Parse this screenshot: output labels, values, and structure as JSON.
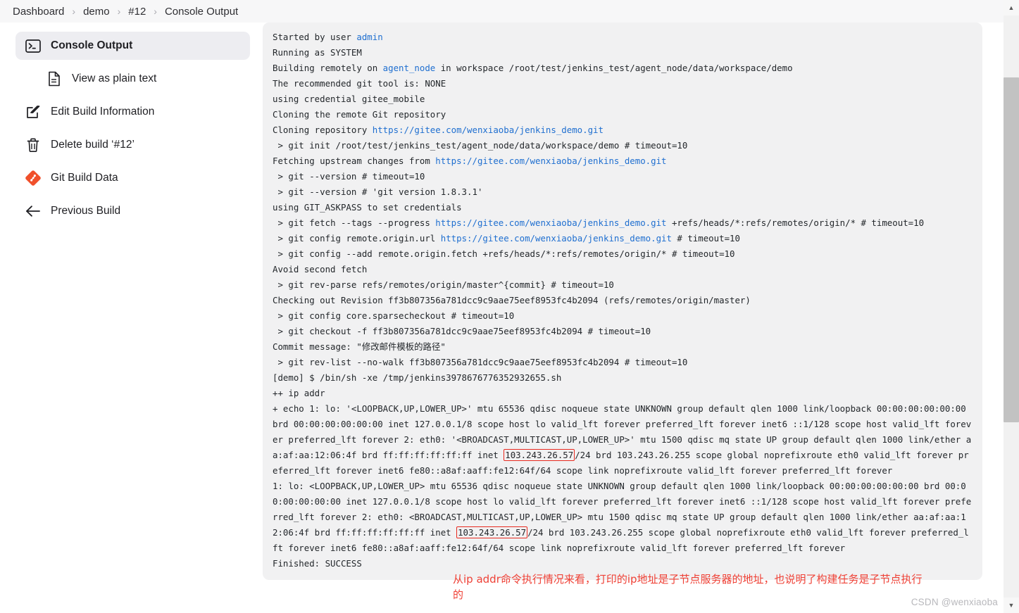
{
  "breadcrumb": {
    "separator": "›",
    "items": [
      {
        "label": "Dashboard"
      },
      {
        "label": "demo"
      },
      {
        "label": "#12"
      },
      {
        "label": "Console Output"
      }
    ]
  },
  "sidebar": {
    "items": [
      {
        "label": "Console Output",
        "icon": "terminal-icon",
        "active": true
      },
      {
        "label": "View as plain text",
        "icon": "document-icon",
        "active": false
      },
      {
        "label": "Edit Build Information",
        "icon": "edit-pencil-icon",
        "active": false
      },
      {
        "label": "Delete build ‘#12’",
        "icon": "trash-icon",
        "active": false
      },
      {
        "label": "Git Build Data",
        "icon": "git-logo-icon",
        "active": false
      },
      {
        "label": "Previous Build",
        "icon": "arrow-left-icon",
        "active": false
      }
    ]
  },
  "console": {
    "lines": [
      [
        {
          "t": "Started by user "
        },
        {
          "t": "admin",
          "c": "link"
        }
      ],
      [
        {
          "t": "Running as SYSTEM"
        }
      ],
      [
        {
          "t": "Building remotely on "
        },
        {
          "t": "agent_node",
          "c": "link"
        },
        {
          "t": " in workspace /root/test/jenkins_test/agent_node/data/workspace/demo"
        }
      ],
      [
        {
          "t": "The recommended git tool is: NONE"
        }
      ],
      [
        {
          "t": "using credential gitee_mobile"
        }
      ],
      [
        {
          "t": "Cloning the remote Git repository"
        }
      ],
      [
        {
          "t": "Cloning repository "
        },
        {
          "t": "https://gitee.com/wenxiaoba/jenkins_demo.git",
          "c": "link"
        }
      ],
      [
        {
          "t": " > git init /root/test/jenkins_test/agent_node/data/workspace/demo # timeout=10"
        }
      ],
      [
        {
          "t": "Fetching upstream changes from "
        },
        {
          "t": "https://gitee.com/wenxiaoba/jenkins_demo.git",
          "c": "link"
        }
      ],
      [
        {
          "t": " > git --version # timeout=10"
        }
      ],
      [
        {
          "t": " > git --version # 'git version 1.8.3.1'"
        }
      ],
      [
        {
          "t": "using GIT_ASKPASS to set credentials "
        }
      ],
      [
        {
          "t": " > git fetch --tags --progress "
        },
        {
          "t": "https://gitee.com/wenxiaoba/jenkins_demo.git",
          "c": "link"
        },
        {
          "t": " +refs/heads/*:refs/remotes/origin/* # timeout=10"
        }
      ],
      [
        {
          "t": " > git config remote.origin.url "
        },
        {
          "t": "https://gitee.com/wenxiaoba/jenkins_demo.git",
          "c": "link"
        },
        {
          "t": " # timeout=10"
        }
      ],
      [
        {
          "t": " > git config --add remote.origin.fetch +refs/heads/*:refs/remotes/origin/* # timeout=10"
        }
      ],
      [
        {
          "t": "Avoid second fetch"
        }
      ],
      [
        {
          "t": " > git rev-parse refs/remotes/origin/master^{commit} # timeout=10"
        }
      ],
      [
        {
          "t": "Checking out Revision ff3b807356a781dcc9c9aae75eef8953fc4b2094 (refs/remotes/origin/master)"
        }
      ],
      [
        {
          "t": " > git config core.sparsecheckout # timeout=10"
        }
      ],
      [
        {
          "t": " > git checkout -f ff3b807356a781dcc9c9aae75eef8953fc4b2094 # timeout=10"
        }
      ],
      [
        {
          "t": "Commit message: \"修改邮件模板的路径\""
        }
      ],
      [
        {
          "t": " > git rev-list --no-walk ff3b807356a781dcc9c9aae75eef8953fc4b2094 # timeout=10"
        }
      ],
      [
        {
          "t": "[demo] $ /bin/sh -xe /tmp/jenkins3978676776352932655.sh"
        }
      ],
      [
        {
          "t": "++ ip addr"
        }
      ],
      [
        {
          "t": "+ echo 1: lo: '<LOOPBACK,UP,LOWER_UP>' mtu 65536 qdisc noqueue state UNKNOWN group default qlen 1000 link/loopback 00:00:00:00:00:00 brd 00:00:00:00:00:00 inet 127.0.0.1/8 scope host lo valid_lft forever preferred_lft forever inet6 ::1/128 scope host valid_lft forever preferred_lft forever 2: eth0: '<BROADCAST,MULTICAST,UP,LOWER_UP>' mtu 1500 qdisc mq state UP group default qlen 1000 link/ether aa:af:aa:12:06:4f brd ff:ff:ff:ff:ff:ff inet "
        },
        {
          "t": "103.243.26.57",
          "c": "ipbox"
        },
        {
          "t": "/24 brd 103.243.26.255 scope global noprefixroute eth0 valid_lft forever preferred_lft forever inet6 fe80::a8af:aaff:fe12:64f/64 scope link noprefixroute valid_lft forever preferred_lft forever"
        }
      ],
      [
        {
          "t": "1: lo: <LOOPBACK,UP,LOWER_UP> mtu 65536 qdisc noqueue state UNKNOWN group default qlen 1000 link/loopback 00:00:00:00:00:00 brd 00:00:00:00:00:00 inet 127.0.0.1/8 scope host lo valid_lft forever preferred_lft forever inet6 ::1/128 scope host valid_lft forever preferred_lft forever 2: eth0: <BROADCAST,MULTICAST,UP,LOWER_UP> mtu 1500 qdisc mq state UP group default qlen 1000 link/ether aa:af:aa:12:06:4f brd ff:ff:ff:ff:ff:ff inet "
        },
        {
          "t": "103.243.26.57",
          "c": "ipbox"
        },
        {
          "t": "/24 brd 103.243.26.255 scope global noprefixroute eth0 valid_lft forever preferred_lft forever inet6 fe80::a8af:aaff:fe12:64f/64 scope link noprefixroute valid_lft forever preferred_lft forever"
        }
      ],
      [
        {
          "t": "Finished: SUCCESS"
        }
      ]
    ]
  },
  "annotation": {
    "text": "从ip addr命令执行情况来看，打印的ip地址是子节点服务器的地址，也说明了构建任务是子节点执行的"
  },
  "watermark": {
    "text": "CSDN @wenxiaoba"
  },
  "scrollbar": {
    "up_arrow": "▲",
    "down_arrow": "▼"
  },
  "colors": {
    "link": "#1f6fd0",
    "highlight_border": "#e8291f",
    "annotation": "#ef4136",
    "console_bg": "#f1f1f2",
    "active_item_bg": "#ededf1",
    "git_orange": "#f0502b"
  }
}
